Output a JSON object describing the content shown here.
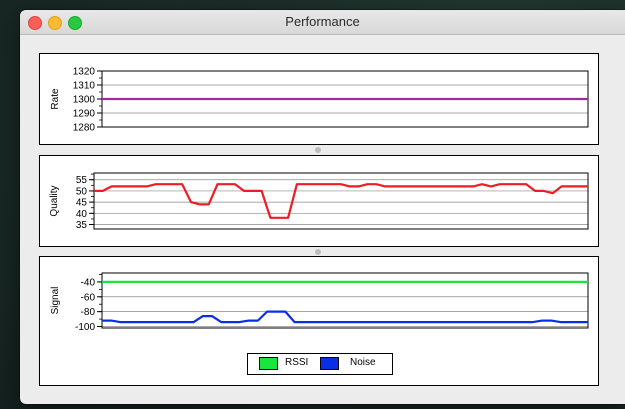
{
  "window": {
    "title": "Performance"
  },
  "charts": [
    {
      "ylabel": "Rate",
      "ylim": [
        1280,
        1320
      ],
      "yticks": [
        "1320",
        "1310",
        "1300",
        "1290",
        "1280"
      ],
      "tickvals": [
        1320,
        1310,
        1300,
        1290,
        1280
      ],
      "series": [
        {
          "color": "#9b2f9b",
          "values": [
            1300,
            1300,
            1300,
            1300,
            1300,
            1300,
            1300,
            1300,
            1300,
            1300,
            1300,
            1300,
            1300,
            1300,
            1300,
            1300,
            1300,
            1300,
            1300,
            1300,
            1300,
            1300,
            1300,
            1300,
            1300,
            1300,
            1300,
            1300,
            1300,
            1300,
            1300,
            1300,
            1300,
            1300,
            1300,
            1300,
            1300,
            1300,
            1300,
            1300,
            1300,
            1300,
            1300,
            1300,
            1300,
            1300,
            1300,
            1300,
            1300,
            1300
          ]
        }
      ]
    },
    {
      "ylabel": "Quality",
      "ylim": [
        33,
        58
      ],
      "yticks": [
        "55",
        "50",
        "45",
        "40",
        "35"
      ],
      "tickvals": [
        55,
        50,
        45,
        40,
        35
      ],
      "series": [
        {
          "color": "#ee1c25",
          "values": [
            50,
            50,
            52,
            52,
            52,
            52,
            52,
            53,
            53,
            53,
            53,
            45,
            44,
            44,
            53,
            53,
            53,
            50,
            50,
            50,
            38,
            38,
            38,
            53,
            53,
            53,
            53,
            53,
            53,
            52,
            52,
            53,
            53,
            52,
            52,
            52,
            52,
            52,
            52,
            52,
            52,
            52,
            52,
            52,
            53,
            52,
            53,
            53,
            53,
            53,
            50,
            50,
            49,
            52,
            52,
            52,
            52
          ]
        }
      ]
    },
    {
      "ylabel": "Signal",
      "ylim": [
        -102,
        -28
      ],
      "yticks": [
        "-40",
        "-60",
        "-80",
        "-100"
      ],
      "tickvals": [
        -40,
        -60,
        -80,
        -100
      ],
      "series": [
        {
          "name": "RSSI",
          "color": "#19e63c",
          "values": [
            -40,
            -40,
            -40,
            -40,
            -40,
            -40,
            -40,
            -40,
            -40,
            -40,
            -40,
            -40,
            -40,
            -40,
            -40,
            -40,
            -40,
            -40,
            -40,
            -40,
            -40,
            -40,
            -40,
            -40,
            -40,
            -40,
            -40,
            -40,
            -40,
            -40,
            -40,
            -40,
            -40,
            -40,
            -40,
            -40,
            -40,
            -40,
            -40,
            -40,
            -40,
            -40,
            -40,
            -40,
            -40,
            -40,
            -40,
            -40,
            -40,
            -40
          ]
        },
        {
          "name": "Noise",
          "color": "#0a2ee6",
          "values": [
            -92,
            -92,
            -94,
            -94,
            -94,
            -94,
            -94,
            -94,
            -94,
            -94,
            -94,
            -86,
            -86,
            -94,
            -94,
            -94,
            -92,
            -92,
            -80,
            -80,
            -80,
            -94,
            -94,
            -94,
            -94,
            -94,
            -94,
            -94,
            -94,
            -94,
            -94,
            -94,
            -94,
            -94,
            -94,
            -94,
            -94,
            -94,
            -94,
            -94,
            -94,
            -94,
            -94,
            -94,
            -94,
            -94,
            -94,
            -94,
            -92,
            -92,
            -94,
            -94,
            -94,
            -94
          ]
        }
      ]
    }
  ],
  "legend": [
    {
      "label": "RSSI",
      "color": "#19e63c"
    },
    {
      "label": "Noise",
      "color": "#0a2ee6"
    }
  ]
}
